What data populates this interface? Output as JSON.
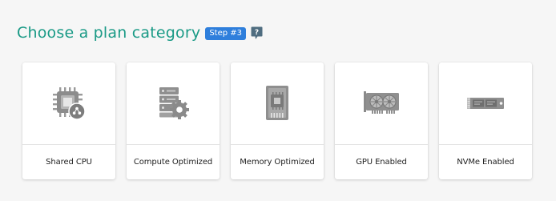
{
  "header": {
    "title": "Choose a plan category",
    "step_badge": "Step #3"
  },
  "cards": [
    {
      "label": "Shared CPU",
      "icon": "shared-cpu-icon"
    },
    {
      "label": "Compute Optimized",
      "icon": "compute-server-icon"
    },
    {
      "label": "Memory Optimized",
      "icon": "memory-module-icon"
    },
    {
      "label": "GPU Enabled",
      "icon": "gpu-card-icon"
    },
    {
      "label": "NVMe Enabled",
      "icon": "nvme-drive-icon"
    }
  ],
  "colors": {
    "title": "#1a9a86",
    "badge": "#2f7fdc",
    "icon_gray": "#8a8a8a"
  }
}
